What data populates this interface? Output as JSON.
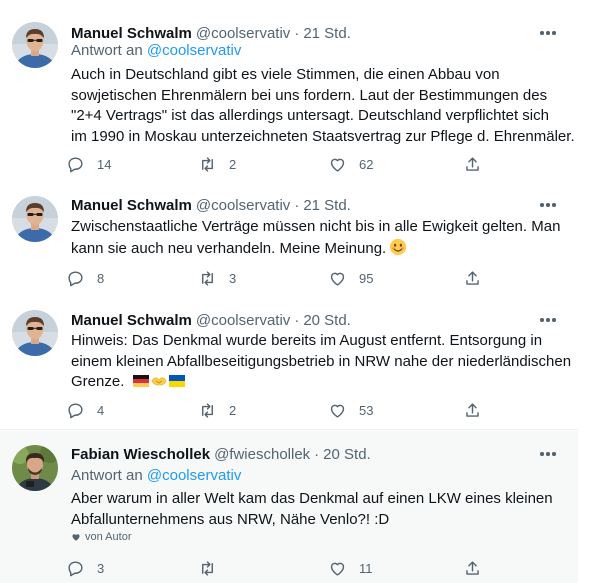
{
  "colors": {
    "accent": "#1d9bf0",
    "text": "#0f1419",
    "muted": "#536471",
    "thread_line": "#cfd9de",
    "highlight_bg": "#f7f9f9"
  },
  "tweets": [
    {
      "name": "Manuel Schwalm",
      "handle": "@coolservativ",
      "sep": "·",
      "time": "21 Std.",
      "reply_prefix": "Antwort an",
      "reply_handle": "@coolservativ",
      "lines": [
        "Auch in Deutschland gibt es viele Stimmen, die einen Abbau von",
        "sowjetischen Ehrenmälern bei uns fordern. Laut der Bestimmungen des",
        "\"2+4 Vertrags\" ist das allerdings untersagt. Deutschland verpflichtet sich",
        "im 1990 in Moskau unterzeichneten Staatsvertrag zur Pflege d. Ehrenmäler."
      ],
      "replies": "14",
      "retweets": "2",
      "likes": "62"
    },
    {
      "name": "Manuel Schwalm",
      "handle": "@coolservativ",
      "sep": "·",
      "time": "21 Std.",
      "lines": [
        "Zwischenstaatliche Verträge müssen nicht bis in alle Ewigkeit gelten. Man",
        "kann sie auch neu verhandeln. Meine Meinung."
      ],
      "emoji": "smiling-face-emoji",
      "replies": "8",
      "retweets": "3",
      "likes": "95"
    },
    {
      "name": "Manuel Schwalm",
      "handle": "@coolservativ",
      "sep": "·",
      "time": "20 Std.",
      "lines": [
        "Hinweis: Das Denkmal wurde bereits im August entfernt. Entsorgung in",
        "einem kleinen Abfallbeseitigungsbetrieb in NRW nahe der niederländischen",
        "Grenze."
      ],
      "emoji_icons": [
        "germany-flag-icon",
        "handshake-icon",
        "ukraine-flag-icon"
      ],
      "replies": "4",
      "retweets": "2",
      "likes": "53"
    },
    {
      "name": "Fabian Wieschollek",
      "handle": "@fwieschollek",
      "sep": "·",
      "time": "20 Std.",
      "reply_prefix": "Antwort an",
      "reply_handle": "@coolservativ",
      "lines": [
        "Aber warum in aller Welt kam das Denkmal auf einen LKW eines kleinen",
        "Abfallunternehmens aus NRW, Nähe Venlo?! :D"
      ],
      "badge": "von Autor",
      "replies": "3",
      "retweets": "",
      "likes": "11"
    }
  ]
}
